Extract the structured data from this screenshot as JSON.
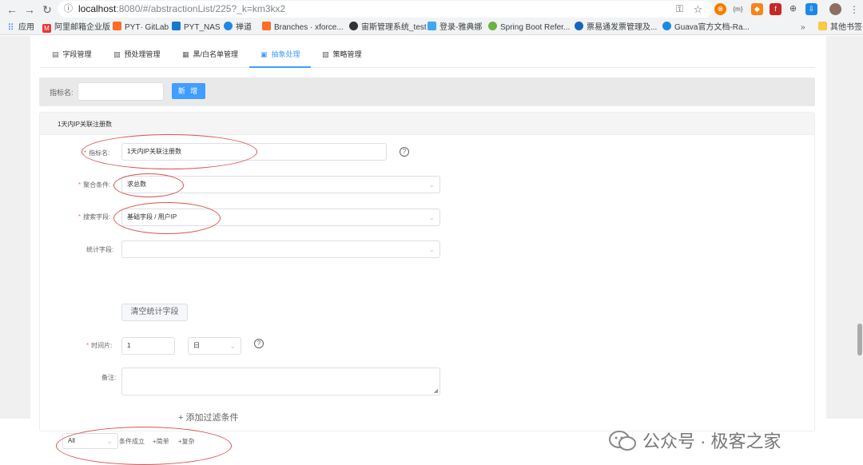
{
  "browser": {
    "url_host": "localhost",
    "url_rest": ":8080/#/abstractionList/225?_k=km3kx2",
    "toolbar_icons": [
      "back-icon",
      "forward-icon",
      "reload-icon",
      "key-icon",
      "star-icon",
      "extension-icon",
      "menu-icon"
    ]
  },
  "bookmarks": [
    {
      "label": "应用",
      "color": "#4285f4"
    },
    {
      "label": "阿里邮箱企业版",
      "color": "#e53935",
      "mark": "M"
    },
    {
      "label": "PYT· GitLab",
      "color": "#fc6d26"
    },
    {
      "label": "PYT_NAS",
      "color": "#1976d2"
    },
    {
      "label": "禅道",
      "color": "#1e88e5"
    },
    {
      "label": "Branches · xforce...",
      "color": "#fc6d26"
    },
    {
      "label": "宙斯管理系统_test",
      "color": "#333333"
    },
    {
      "label": "登录-雅典娜",
      "color": "#42a5f5"
    },
    {
      "label": "Spring Boot Refer...",
      "color": "#6db33f"
    },
    {
      "label": "票易通发票管理及...",
      "color": "#1565c0"
    },
    {
      "label": "Guava官方文档-Ra...",
      "color": "#1e88e5"
    },
    {
      "label": "其他书签",
      "color": "#f9c846"
    }
  ],
  "tabs": [
    {
      "label": "字段管理",
      "icon": "field-icon"
    },
    {
      "label": "预处理管理",
      "icon": "preprocess-icon"
    },
    {
      "label": "黑/白名单管理",
      "icon": "grid-icon"
    },
    {
      "label": "抽象处理",
      "icon": "abstraction-icon",
      "active": true
    },
    {
      "label": "策略管理",
      "icon": "policy-icon"
    }
  ],
  "search": {
    "label": "指标名:",
    "placeholder": "",
    "add_button": "新 增"
  },
  "card": {
    "title": "1天内IP关联注册数"
  },
  "form": {
    "name": {
      "label": "指标名:",
      "value": "1天内IP关联注册数"
    },
    "aggregate": {
      "label": "聚合条件:",
      "value": "求总数"
    },
    "search_field": {
      "label": "搜索字段:",
      "value": "基础字段 / 用户IP"
    },
    "stat_field": {
      "label": "统计字段:",
      "value": ""
    },
    "clear_button": "清空统计字段",
    "time_slice": {
      "label": "时间片:",
      "value": "1",
      "unit": "日"
    },
    "remark": {
      "label": "备注:",
      "value": ""
    },
    "add_filter": "+ 添加过滤条件",
    "logic": {
      "value": "All"
    },
    "condition_text": "条件成立",
    "add_simple": "+简单",
    "add_complex": "+复杂"
  },
  "watermark": "公众号 · 极客之家"
}
